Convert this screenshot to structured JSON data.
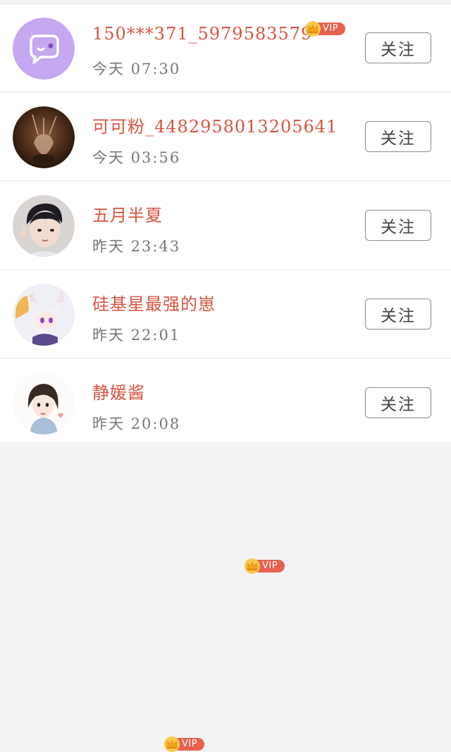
{
  "follow_label": "关注",
  "vip_label": "VIP",
  "users": [
    {
      "name": "150***371_5979583579",
      "time": "今天 07:30",
      "avatar": "chat-bubble-avatar"
    },
    {
      "name": "可可粉_4482958013205641",
      "time": "今天 03:56",
      "avatar": "photo-avatar"
    },
    {
      "name": "五月半夏",
      "time": "昨天 23:43",
      "avatar": "photo-avatar"
    },
    {
      "name": "硅基星最强的崽",
      "time": "昨天 22:01",
      "avatar": "anime-avatar"
    },
    {
      "name": "静媛酱",
      "time": "昨天 20:08",
      "avatar": "illustration-avatar"
    }
  ],
  "colors": {
    "name": "#d8543f",
    "vip": "#e8604f",
    "crown": "#f2b51e",
    "default_avatar": "#c5a8f0"
  }
}
